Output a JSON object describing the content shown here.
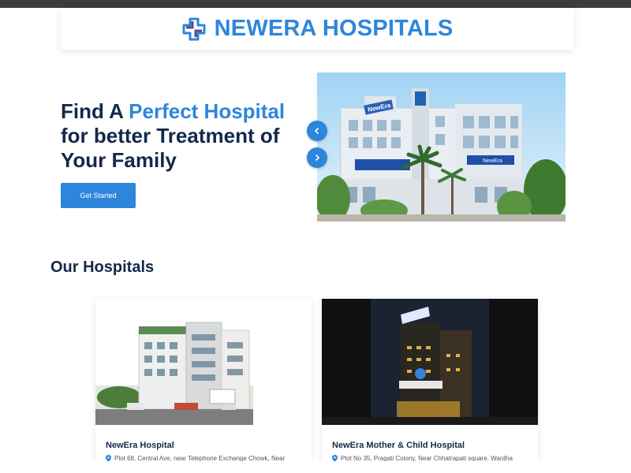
{
  "header": {
    "brand": "NEWERA HOSPITALS",
    "logo_icon": "cross-logo-icon"
  },
  "hero": {
    "title_part1": "Find A ",
    "title_accent": "Perfect Hospital",
    "title_part2": "for better Treatment of Your Family",
    "cta_label": "Get Started",
    "slider_prev_icon": "chevron-left-icon",
    "slider_next_icon": "chevron-right-icon",
    "building_sign": "NewEra",
    "building_sign_2": "NewEra"
  },
  "hospitals": {
    "section_title": "Our Hospitals",
    "items": [
      {
        "name": "NewEra Hospital",
        "address": "Plot 68, Central Ave, near Telephone Exchange Chowk, Near"
      },
      {
        "name": "NewEra Mother & Child Hospital",
        "address": "Plot No 35, Pragati Colony, Near Chhatrapati square, Wardha"
      }
    ]
  },
  "colors": {
    "accent": "#2d86dc",
    "navy": "#13294b"
  }
}
